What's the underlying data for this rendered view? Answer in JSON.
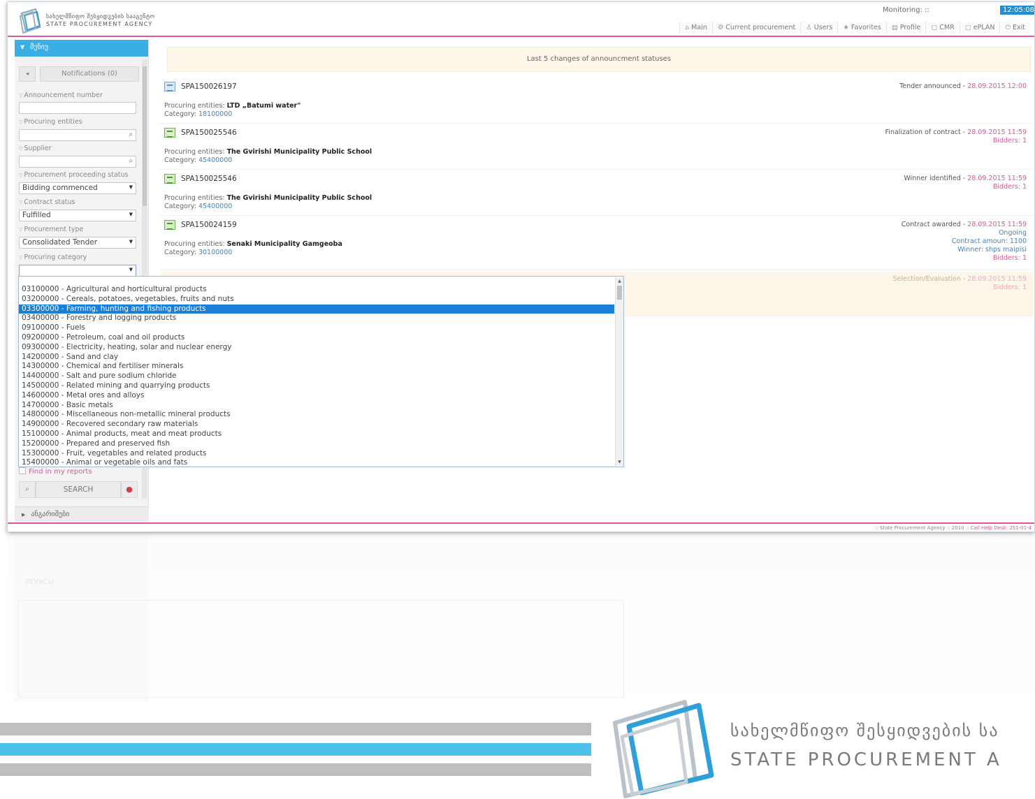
{
  "header": {
    "org_name_ka": "სახელმწიფო შესყიდვების სააგენტო",
    "org_name_en": "STATE PROCUREMENT AGENCY",
    "monitoring_label": "Monitoring: ::",
    "clock": "12:05:08",
    "nav": [
      {
        "icon": "home-icon",
        "label": "Main"
      },
      {
        "icon": "gear-icon",
        "label": "Current procurement"
      },
      {
        "icon": "users-icon",
        "label": "Users"
      },
      {
        "icon": "star-icon",
        "label": "Favorites"
      },
      {
        "icon": "profile-icon",
        "label": "Profile"
      },
      {
        "icon": "doc-icon",
        "label": "CMR"
      },
      {
        "icon": "doc-icon",
        "label": "ePLAN"
      },
      {
        "icon": "power-icon",
        "label": "Exit"
      }
    ]
  },
  "sidebar": {
    "title": "მენიუ",
    "notifications": "Notifications (0)",
    "fields": {
      "announcement_number": {
        "label": "Announcement number",
        "value": ""
      },
      "procuring_entities": {
        "label": "Procuring entities",
        "value": ""
      },
      "supplier": {
        "label": "Supplier",
        "value": ""
      },
      "proceeding_status": {
        "label": "Procurement proceeding status",
        "value": "Bidding commenced"
      },
      "contract_status": {
        "label": "Contract status",
        "value": "Fulfilled"
      },
      "procurement_type": {
        "label": "Procurement type",
        "value": "Consolidated Tender"
      },
      "procuring_category": {
        "label": "Procuring category",
        "value": ""
      }
    },
    "find_in_reports": "Find in my reports",
    "search_label": "SEARCH",
    "footer_label": "ანგარიშები"
  },
  "main": {
    "banner": "Last 5 changes of announcment statuses",
    "proc_prefix": "Procuring entities:",
    "cat_prefix": "Category:",
    "entries": [
      {
        "id": "SPA150026197",
        "entity": "LTD „Batumi water\"",
        "category": "18100000",
        "status": "Tender announced",
        "date": "28.09.2015 12:00",
        "extra": []
      },
      {
        "id": "SPA150025546",
        "entity": "The Gvirishi Municipality Public School",
        "category": "45400000",
        "status": "Finalization of contract",
        "date": "28.09.2015 11:59",
        "extra": [
          "Bidders: 1"
        ]
      },
      {
        "id": "SPA150025546",
        "entity": "The Gvirishi Municipality Public School",
        "category": "45400000",
        "status": "Winner identified",
        "date": "28.09.2015 11:59",
        "extra": [
          "Bidders: 1"
        ]
      },
      {
        "id": "SPA150024159",
        "entity": "Senaki Municipality Gamgeoba",
        "category": "30100000",
        "status": "Contract awarded",
        "date": "28.09.2015 11:59",
        "extra": [
          "Ongoing",
          "Contract amoun: 1100",
          "Winner: shps maipisi",
          "Bidders: 1"
        ]
      },
      {
        "status": "Selection/Evaluation",
        "date": "28.09.2015 11:59",
        "extra": [
          "Bidders: 1"
        ]
      }
    ]
  },
  "dropdown": {
    "selected_index": 2,
    "items": [
      "03100000 - Agricultural and horticultural products",
      "03200000 - Cereals, potatoes, vegetables, fruits and nuts",
      "03300000 - Farming, hunting and fishing products",
      "03400000 - Forestry and logging products",
      "09100000 - Fuels",
      "09200000 - Petroleum, coal and oil products",
      "09300000 - Electricity, heating, solar and nuclear energy",
      "14200000 - Sand and clay",
      "14300000 - Chemical and fertiliser minerals",
      "14400000 - Salt and pure sodium chloride",
      "14500000 - Related mining and quarrying products",
      "14600000 - Metal ores and alloys",
      "14700000 - Basic metals",
      "14800000 - Miscellaneous non-metallic mineral products",
      "14900000 - Recovered secondary raw materials",
      "15100000 - Animal products, meat and meat products",
      "15200000 - Prepared and preserved fish",
      "15300000 - Fruit, vegetables and related products",
      "15400000 - Animal or vegetable oils and fats"
    ]
  },
  "footer": {
    "agency": ":: State Procurement Agency :: 2010 ::",
    "helpdesk": "Call Help Desk: 251-01-4"
  },
  "branding": {
    "name_ka": "სახელმწიფო შესყიდვების სა",
    "name_en": "STATE PROCUREMENT A"
  },
  "colors": {
    "accent_blue": "#3aaee6",
    "accent_pink": "#e2569a",
    "selection": "#1a7fd8"
  }
}
